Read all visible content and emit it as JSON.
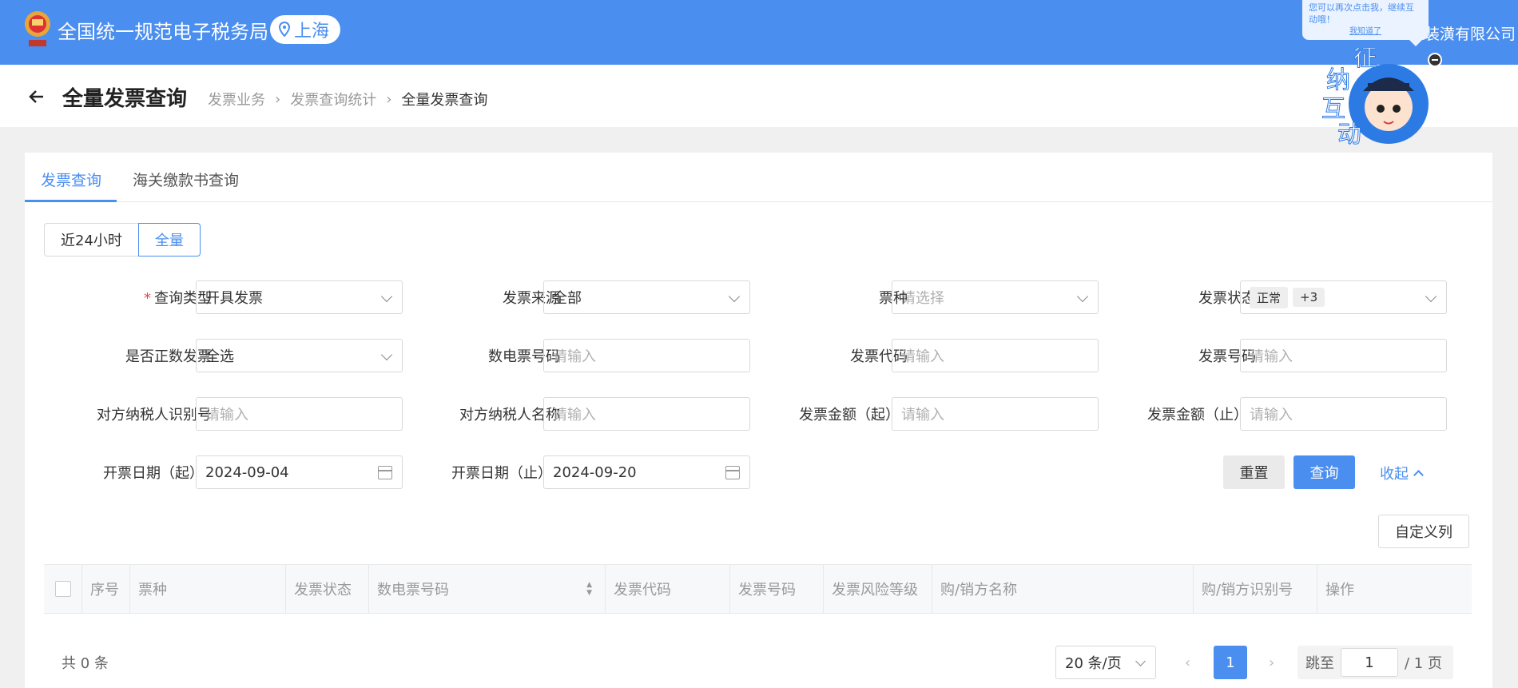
{
  "header": {
    "app_title": "全国统一规范电子税务局",
    "region": "上海",
    "company": "装潢有限公司",
    "assistant_bubble_text": "您可以再次点击我，继续互动哦！",
    "assistant_bubble_link": "我知道了",
    "mascot_chars": "征纳互动"
  },
  "page": {
    "title": "全量发票查询",
    "breadcrumb": [
      "发票业务",
      "发票查询统计",
      "全量发票查询"
    ]
  },
  "tabs": [
    "发票查询",
    "海关缴款书查询"
  ],
  "range": [
    "近24小时",
    "全量"
  ],
  "filters": {
    "query_type": {
      "label": "查询类型",
      "value": "开具发票"
    },
    "invoice_source": {
      "label": "发票来源",
      "value": "全部"
    },
    "ticket_kind": {
      "label": "票种",
      "placeholder": "请选择"
    },
    "invoice_status": {
      "label": "发票状态",
      "tag": "正常",
      "more": "+3"
    },
    "positive_invoice": {
      "label": "是否正数发票",
      "value": "全选"
    },
    "digital_no": {
      "label": "数电票号码",
      "placeholder": "请输入"
    },
    "invoice_code": {
      "label": "发票代码",
      "placeholder": "请输入"
    },
    "invoice_no": {
      "label": "发票号码",
      "placeholder": "请输入"
    },
    "counter_tax_id": {
      "label": "对方纳税人识别号",
      "placeholder": "请输入"
    },
    "counter_name": {
      "label": "对方纳税人名称",
      "placeholder": "请输入"
    },
    "amount_from": {
      "label": "发票金额（起）",
      "placeholder": "请输入"
    },
    "amount_to": {
      "label": "发票金额（止）",
      "placeholder": "请输入"
    },
    "date_from": {
      "label": "开票日期（起）",
      "value": "2024-09-04"
    },
    "date_to": {
      "label": "开票日期（止）",
      "value": "2024-09-20"
    }
  },
  "actions": {
    "reset": "重置",
    "query": "查询",
    "collapse": "收起",
    "custom_columns": "自定义列"
  },
  "table": {
    "columns": [
      "序号",
      "票种",
      "发票状态",
      "数电票号码",
      "发票代码",
      "发票号码",
      "发票风险等级",
      "购/销方名称",
      "购/销方识别号",
      "操作"
    ],
    "rows": []
  },
  "pagination": {
    "total": "共 0 条",
    "page_size": "20 条/页",
    "current_page": "1",
    "jump_label": "跳至",
    "jump_value": "1",
    "total_pages": "/ 1 页"
  },
  "colors": {
    "primary": "#4a8ef0",
    "required": "#e54545"
  }
}
